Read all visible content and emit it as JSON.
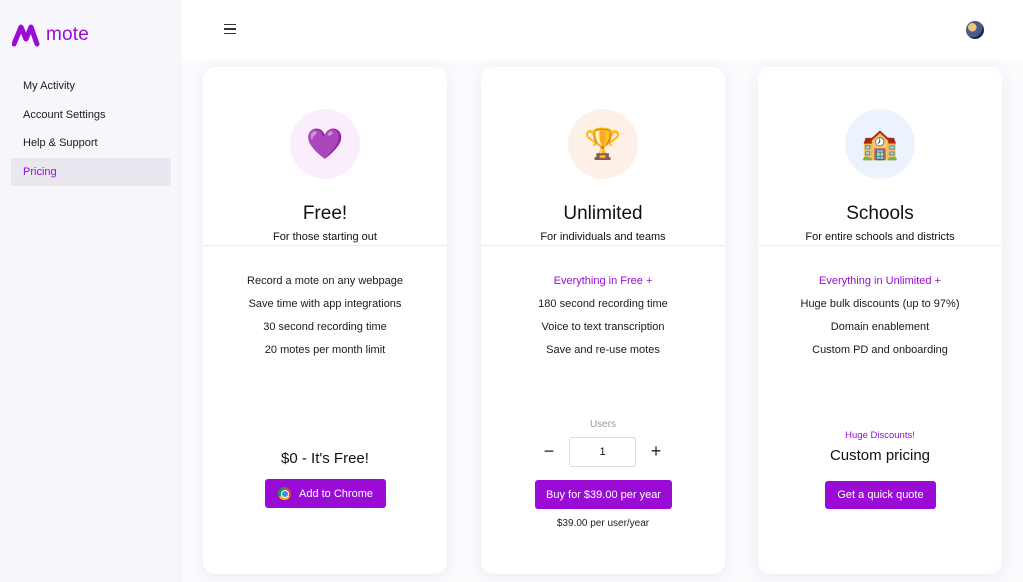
{
  "brand": {
    "name": "mote",
    "color": "#9a0bd6",
    "logo_icon": "mote-logo-icon"
  },
  "sidebar": {
    "items": [
      {
        "label": "My Activity",
        "active": false
      },
      {
        "label": "Account Settings",
        "active": false
      },
      {
        "label": "Help & Support",
        "active": false
      },
      {
        "label": "Pricing",
        "active": true
      }
    ]
  },
  "topbar": {
    "menu_icon": "hamburger-menu-icon",
    "avatar_icon": "user-avatar"
  },
  "plans": [
    {
      "icon": "purple-heart-emoji",
      "emoji": "💜",
      "title": "Free!",
      "subtitle": "For those starting out",
      "features": [
        "Record a mote on any webpage",
        "Save time with app integrations",
        "30 second recording time",
        "20 motes per month limit"
      ],
      "price": "$0 - It's Free!",
      "button_label": "Add to Chrome",
      "button_icon": "chrome-icon"
    },
    {
      "icon": "trophy-emoji",
      "emoji": "🏆",
      "title": "Unlimited",
      "subtitle": "For individuals and teams",
      "features_accent": "Everything in Free +",
      "features": [
        "180 second recording time",
        "Voice to text transcription",
        "Save and re-use motes"
      ],
      "users_label": "Users",
      "quantity": "1",
      "minus": "−",
      "plus": "+",
      "button_label": "Buy for $39.00 per year",
      "per_user": "$39.00 per user/year"
    },
    {
      "icon": "school-building-emoji",
      "emoji": "🏫",
      "title": "Schools",
      "subtitle": "For entire schools and districts",
      "features_accent": "Everything in Unlimited +",
      "features": [
        "Huge bulk discounts (up to 97%)",
        "Domain enablement",
        "Custom PD and onboarding"
      ],
      "discount_note": "Huge Discounts!",
      "price": "Custom pricing",
      "button_label": "Get a quick quote"
    }
  ]
}
